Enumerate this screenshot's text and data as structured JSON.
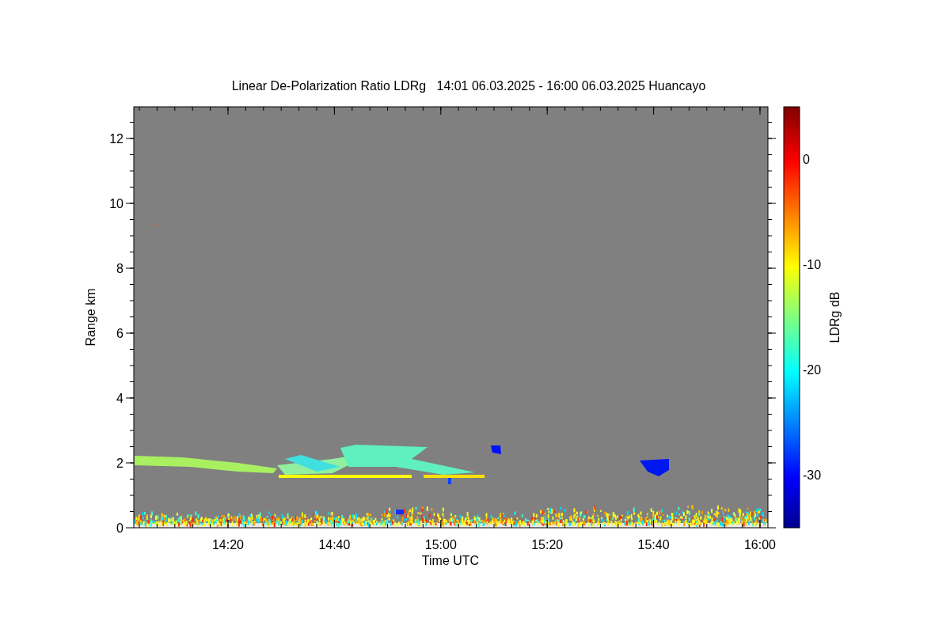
{
  "title": "Linear De-Polarization Ratio LDRg   14:01 06.03.2025 - 16:00 06.03.2025 Huancayo",
  "y_axis": {
    "label": "Range km",
    "ticks": [
      "12",
      "10",
      "8",
      "6",
      "4",
      "2",
      "0"
    ]
  },
  "x_axis": {
    "label": "Time UTC",
    "ticks": [
      "14:20",
      "14:40",
      "15:00",
      "15:20",
      "15:40",
      "16:00"
    ]
  },
  "colorbar": {
    "label": "LDRg dB",
    "ticks": [
      "0",
      "-10",
      "-20",
      "-30"
    ]
  }
}
